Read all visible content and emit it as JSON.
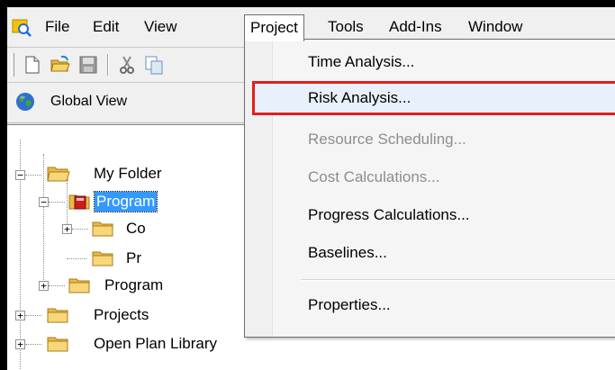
{
  "menubar": {
    "items": [
      {
        "label": "File"
      },
      {
        "label": "Edit"
      },
      {
        "label": "View"
      },
      {
        "label": "Project"
      },
      {
        "label": "Tools"
      },
      {
        "label": "Add-Ins"
      },
      {
        "label": "Window"
      }
    ],
    "open_menu": "Project"
  },
  "toolbar": {
    "buttons": [
      {
        "icon": "new-document-icon"
      },
      {
        "icon": "open-folder-icon"
      },
      {
        "icon": "save-icon"
      },
      {
        "icon": "cut-icon"
      },
      {
        "icon": "copy-icon"
      }
    ]
  },
  "global_view": {
    "label": "Global View",
    "icon": "globe-icon"
  },
  "tree": {
    "nodes": [
      {
        "label": "My Folder",
        "expander": "−"
      },
      {
        "label": "Program",
        "expander": "−",
        "selected": true
      },
      {
        "label": "Co",
        "expander": "+"
      },
      {
        "label": "Pr"
      },
      {
        "label": "Program",
        "expander": "+"
      },
      {
        "label": "Projects",
        "expander": "+"
      },
      {
        "label": "Open Plan Library",
        "expander": "+"
      }
    ]
  },
  "project_menu": {
    "items": [
      {
        "label": "Time Analysis...",
        "enabled": true
      },
      {
        "label": "Risk Analysis...",
        "enabled": true,
        "highlighted": true
      },
      {
        "label": "Resource Scheduling...",
        "enabled": false
      },
      {
        "label": "Cost Calculations...",
        "enabled": false
      },
      {
        "label": "Progress Calculations...",
        "enabled": true
      },
      {
        "label": "Baselines...",
        "enabled": true
      },
      {
        "label": "Properties...",
        "enabled": true
      }
    ]
  },
  "colors": {
    "highlight_border": "#e41e1e",
    "selection": "#3399ff",
    "disabled_text": "#8d8d8d"
  }
}
